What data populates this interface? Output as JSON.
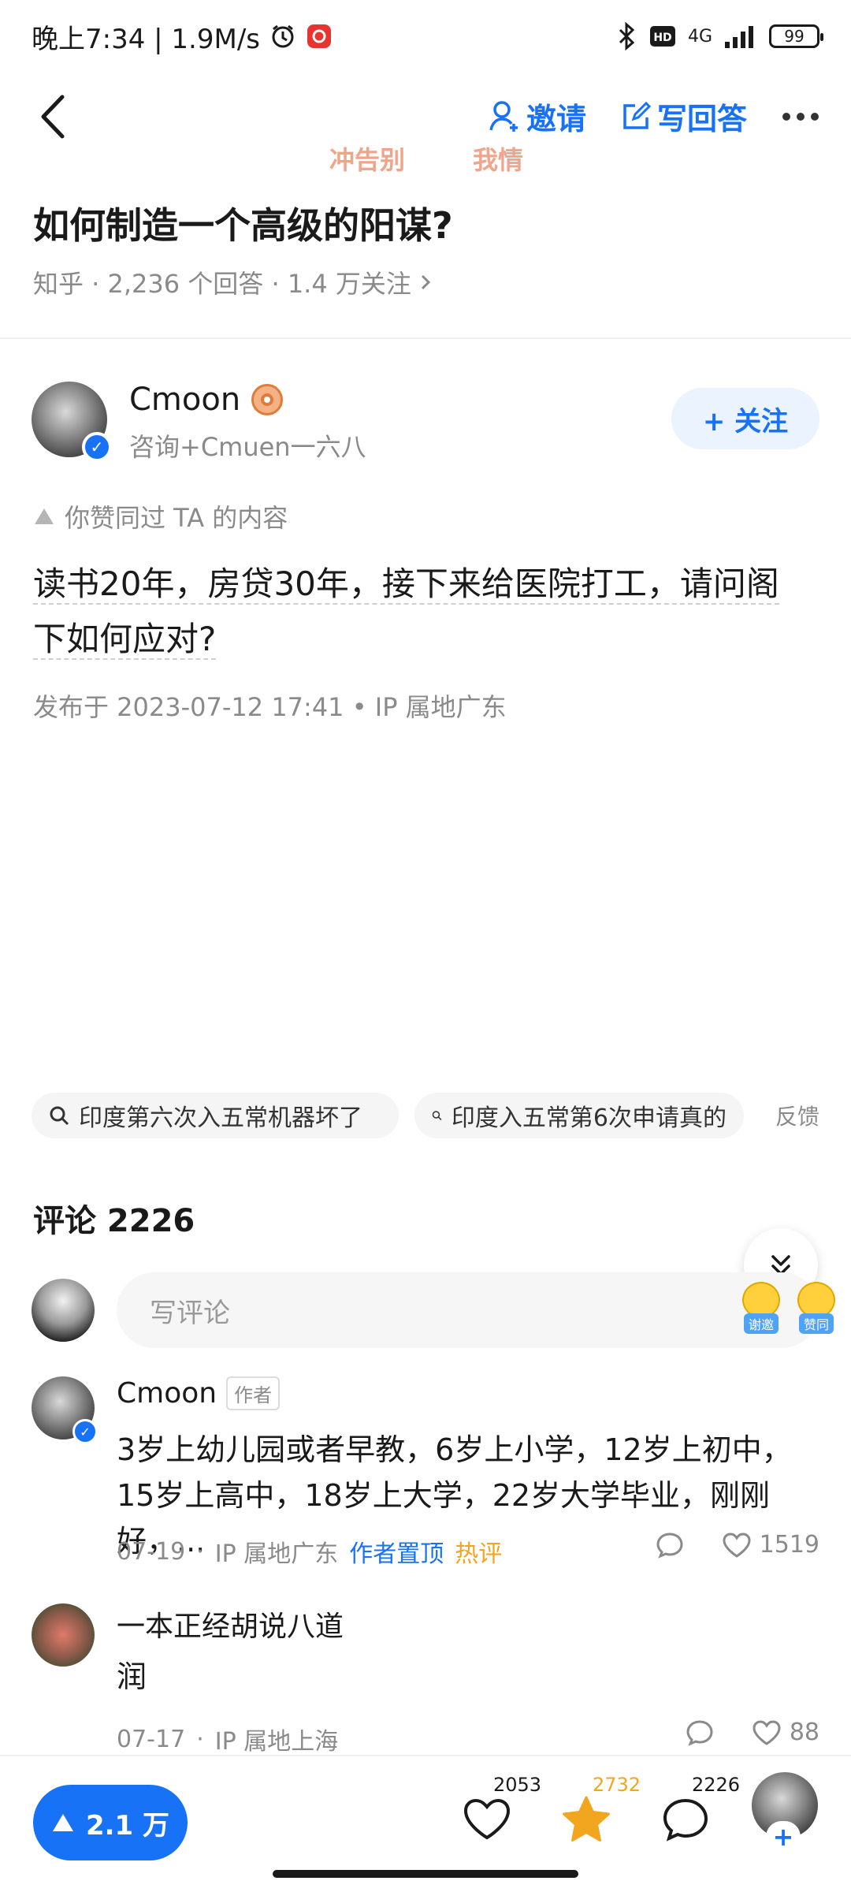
{
  "status_bar": {
    "time_speed": "晚上7:34 | 1.9M/s",
    "network": "4G",
    "battery": "99"
  },
  "nav": {
    "invite_label": "邀请",
    "write_answer_label": "写回答",
    "ticker_left": "冲告别",
    "ticker_right": "我情"
  },
  "question": {
    "title": "如何制造一个高级的阳谋?",
    "meta": "知乎 · 2,236 个回答 · 1.4 万关注"
  },
  "author": {
    "name": "Cmoon",
    "desc": "咨询+Cmuen一六八",
    "follow_label": "+ 关注"
  },
  "answer": {
    "liked_note": "你赞同过 TA 的内容",
    "body": "读书20年，房贷30年，接下来给医院打工，请问阁下如何应对?",
    "published": "发布于 2023-07-12 17:41 • IP 属地广东"
  },
  "related_searches": {
    "items": [
      "印度第六次入五常机器坏了",
      "印度入五常第6次申请真的"
    ],
    "feedback_label": "反馈"
  },
  "comments": {
    "title": "评论 2226",
    "input_placeholder": "写评论",
    "emoji_tags": [
      "谢邀",
      "赞同"
    ],
    "items": [
      {
        "name": "Cmoon",
        "author_tag": "作者",
        "text": "3岁上幼儿园或者早教，6岁上小学，12岁上初中，15岁上高中，18岁上大学，22岁大学毕业，刚刚好，...",
        "date": "07-19",
        "ip": "IP 属地广东",
        "pinned_label": "作者置顶",
        "hot_label": "热评",
        "likes": "1519"
      },
      {
        "name": "一本正经胡说八道",
        "text": "润",
        "date": "07-17",
        "ip": "IP 属地上海",
        "likes": "88"
      }
    ]
  },
  "bottom_bar": {
    "upvote_label": "2.1 万",
    "like_count": "2053",
    "favorite_count": "2732",
    "comment_count": "2226"
  },
  "colors": {
    "accent": "#1772f6",
    "hot": "#f2a51e",
    "muted": "#8a8a8a"
  }
}
